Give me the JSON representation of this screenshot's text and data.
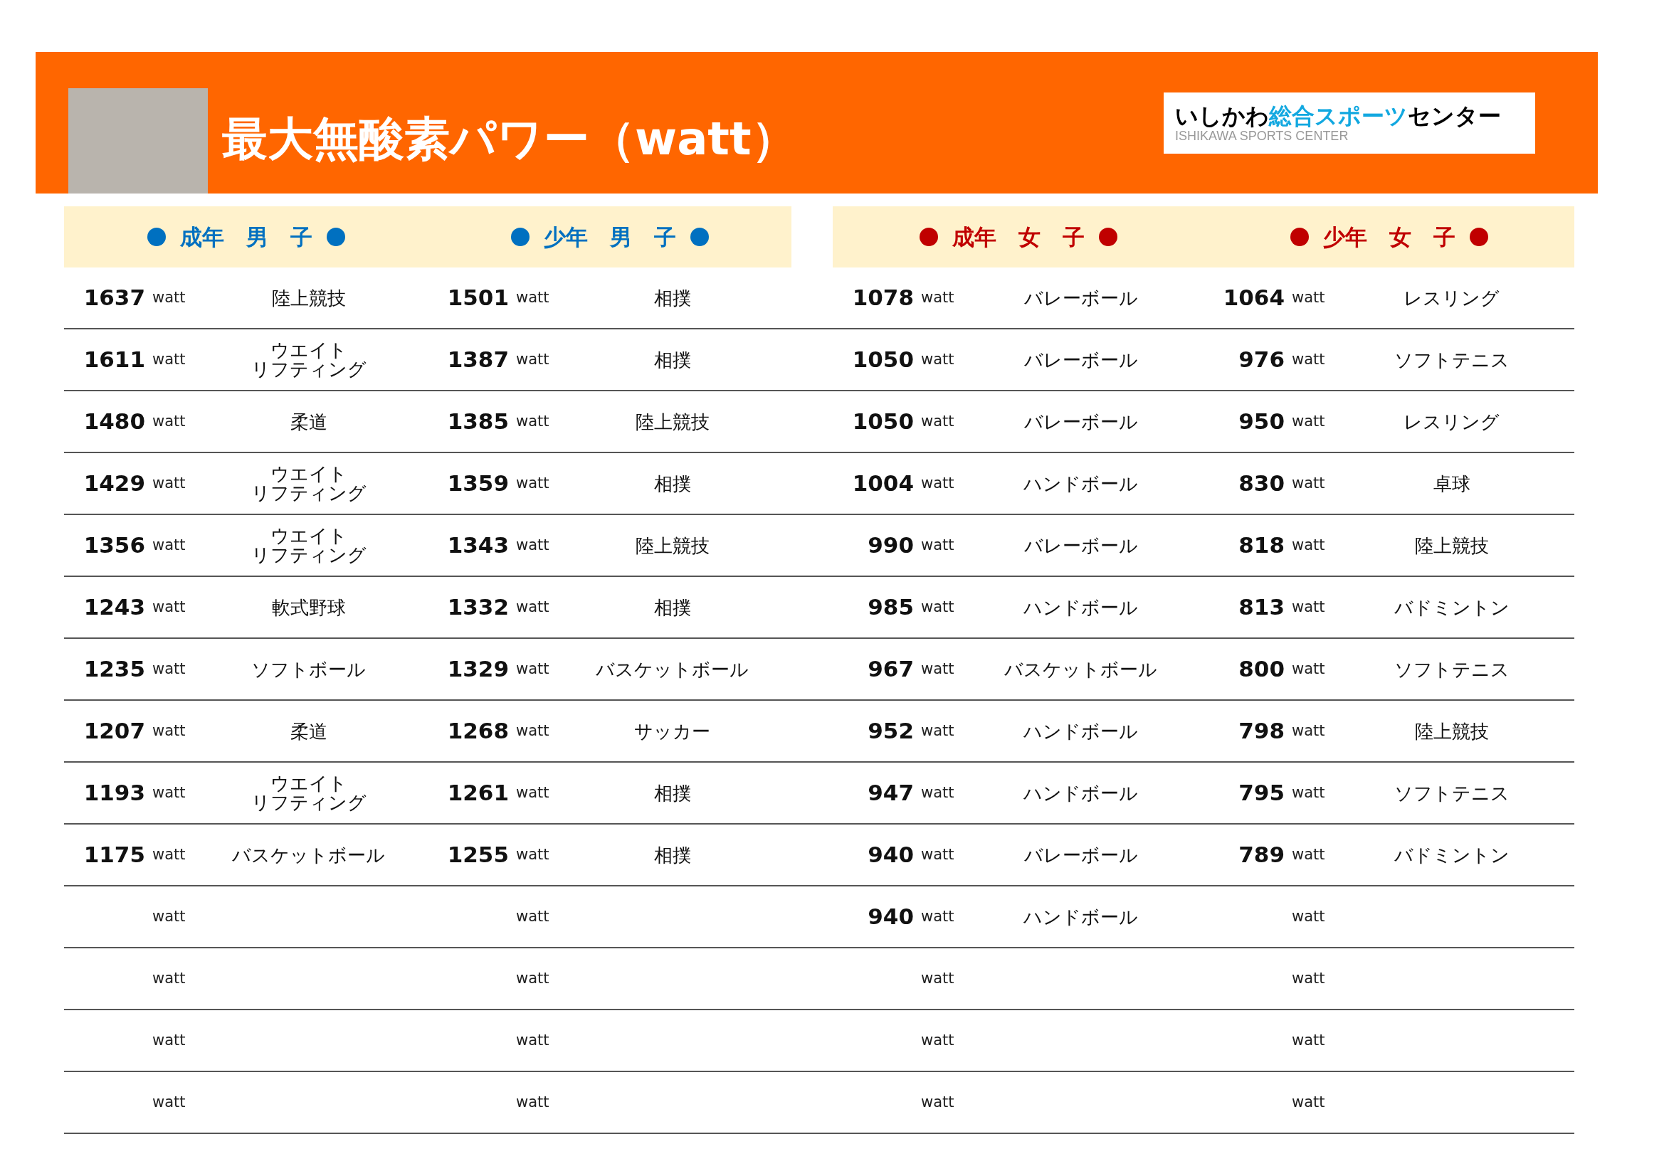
{
  "header": {
    "title": "最大無酸素パワー（watt）",
    "logo": {
      "name_start": "いしかわ",
      "name_highlight": "総合スポーツ",
      "name_end": "センター",
      "subtitle": "ISHIKAWA SPORTS CENTER"
    }
  },
  "groups": [
    {
      "label": "成年　男　子",
      "color": "#0070c0",
      "rows": [
        {
          "value": "1637",
          "unit": "watt",
          "sport": "陸上競技"
        },
        {
          "value": "1611",
          "unit": "watt",
          "sport_lines": [
            "ウエイト",
            "リフティング"
          ]
        },
        {
          "value": "1480",
          "unit": "watt",
          "sport": "柔道"
        },
        {
          "value": "1429",
          "unit": "watt",
          "sport_lines": [
            "ウエイト",
            "リフティング"
          ]
        },
        {
          "value": "1356",
          "unit": "watt",
          "sport_lines": [
            "ウエイト",
            "リフティング"
          ]
        },
        {
          "value": "1243",
          "unit": "watt",
          "sport": "軟式野球"
        },
        {
          "value": "1235",
          "unit": "watt",
          "sport": "ソフトボール"
        },
        {
          "value": "1207",
          "unit": "watt",
          "sport": "柔道"
        },
        {
          "value": "1193",
          "unit": "watt",
          "sport_lines": [
            "ウエイト",
            "リフティング"
          ]
        },
        {
          "value": "1175",
          "unit": "watt",
          "sport": "バスケットボール"
        },
        {
          "unit": "watt"
        },
        {
          "unit": "watt"
        },
        {
          "unit": "watt"
        },
        {
          "unit": "watt"
        }
      ]
    },
    {
      "label": "少年　男　子",
      "color": "#0070c0",
      "rows": [
        {
          "value": "1501",
          "unit": "watt",
          "sport": "相撲"
        },
        {
          "value": "1387",
          "unit": "watt",
          "sport": "相撲"
        },
        {
          "value": "1385",
          "unit": "watt",
          "sport": "陸上競技"
        },
        {
          "value": "1359",
          "unit": "watt",
          "sport": "相撲"
        },
        {
          "value": "1343",
          "unit": "watt",
          "sport": "陸上競技"
        },
        {
          "value": "1332",
          "unit": "watt",
          "sport": "相撲"
        },
        {
          "value": "1329",
          "unit": "watt",
          "sport": "バスケットボール"
        },
        {
          "value": "1268",
          "unit": "watt",
          "sport": "サッカー"
        },
        {
          "value": "1261",
          "unit": "watt",
          "sport": "相撲"
        },
        {
          "value": "1255",
          "unit": "watt",
          "sport": "相撲"
        },
        {
          "unit": "watt"
        },
        {
          "unit": "watt"
        },
        {
          "unit": "watt"
        },
        {
          "unit": "watt"
        }
      ]
    },
    {
      "label": "成年　女　子",
      "color": "#c00000",
      "rows": [
        {
          "value": "1078",
          "unit": "watt",
          "sport": "バレーボール"
        },
        {
          "value": "1050",
          "unit": "watt",
          "sport": "バレーボール"
        },
        {
          "value": "1050",
          "unit": "watt",
          "sport": "バレーボール"
        },
        {
          "value": "1004",
          "unit": "watt",
          "sport": "ハンドボール"
        },
        {
          "value": "990",
          "unit": "watt",
          "sport": "バレーボール"
        },
        {
          "value": "985",
          "unit": "watt",
          "sport": "ハンドボール"
        },
        {
          "value": "967",
          "unit": "watt",
          "sport": "バスケットボール"
        },
        {
          "value": "952",
          "unit": "watt",
          "sport": "ハンドボール"
        },
        {
          "value": "947",
          "unit": "watt",
          "sport": "ハンドボール"
        },
        {
          "value": "940",
          "unit": "watt",
          "sport": "バレーボール"
        },
        {
          "value": "940",
          "unit": "watt",
          "sport": "ハンドボール"
        },
        {
          "unit": "watt"
        },
        {
          "unit": "watt"
        },
        {
          "unit": "watt"
        }
      ]
    },
    {
      "label": "少年　女　子",
      "color": "#c00000",
      "rows": [
        {
          "value": "1064",
          "unit": "watt",
          "sport": "レスリング"
        },
        {
          "value": "976",
          "unit": "watt",
          "sport": "ソフトテニス"
        },
        {
          "value": "950",
          "unit": "watt",
          "sport": "レスリング"
        },
        {
          "value": "830",
          "unit": "watt",
          "sport": "卓球"
        },
        {
          "value": "818",
          "unit": "watt",
          "sport": "陸上競技"
        },
        {
          "value": "813",
          "unit": "watt",
          "sport": "バドミントン"
        },
        {
          "value": "800",
          "unit": "watt",
          "sport": "ソフトテニス"
        },
        {
          "value": "798",
          "unit": "watt",
          "sport": "陸上競技"
        },
        {
          "value": "795",
          "unit": "watt",
          "sport": "ソフトテニス"
        },
        {
          "value": "789",
          "unit": "watt",
          "sport": "バドミントン"
        },
        {
          "unit": "watt"
        },
        {
          "unit": "watt"
        },
        {
          "unit": "watt"
        },
        {
          "unit": "watt"
        }
      ]
    }
  ]
}
